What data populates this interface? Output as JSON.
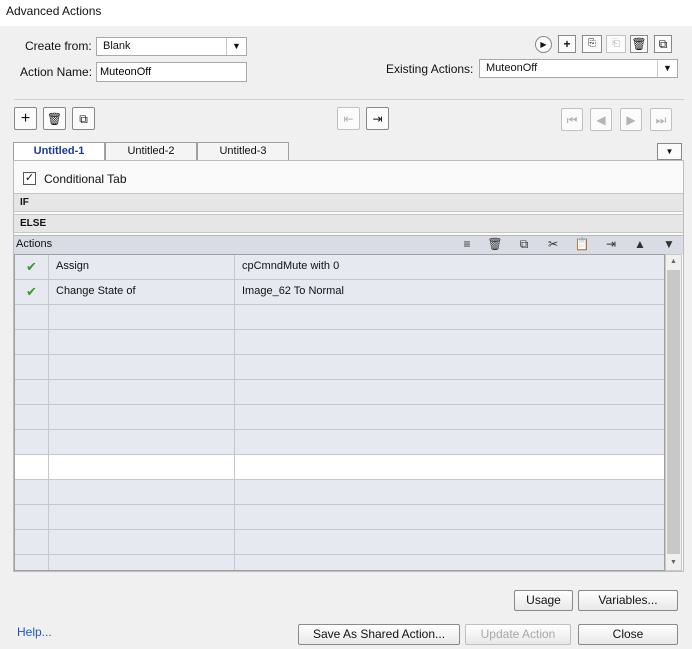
{
  "window": {
    "title": "Advanced Actions"
  },
  "form": {
    "create_from_label": "Create from:",
    "create_from_value": "Blank",
    "action_name_label": "Action Name:",
    "action_name_value": "MuteonOff",
    "existing_actions_label": "Existing Actions:",
    "existing_actions_value": "MuteonOff"
  },
  "tabs": [
    {
      "label": "Untitled-1",
      "active": true
    },
    {
      "label": "Untitled-2",
      "active": false
    },
    {
      "label": "Untitled-3",
      "active": false
    }
  ],
  "conditional": {
    "label": "Conditional Tab",
    "checked": true
  },
  "sections": {
    "if_label": "IF",
    "else_label": "ELSE"
  },
  "actions": {
    "header": "Actions",
    "rows": [
      {
        "checked": true,
        "action": "Assign",
        "target": "cpCmndMute   with   0"
      },
      {
        "checked": true,
        "action": "Change State of",
        "target": "Image_62   To   Normal"
      }
    ],
    "empty_rows": 11,
    "selected_empty_row": 6
  },
  "buttons": {
    "usage": "Usage",
    "variables": "Variables...",
    "save_shared": "Save As Shared Action...",
    "update_action": "Update Action",
    "close": "Close"
  },
  "help_link": "Help...",
  "colors": {
    "accent": "#1a3a9c",
    "check": "#3a9a2a",
    "link": "#1b56c2"
  }
}
